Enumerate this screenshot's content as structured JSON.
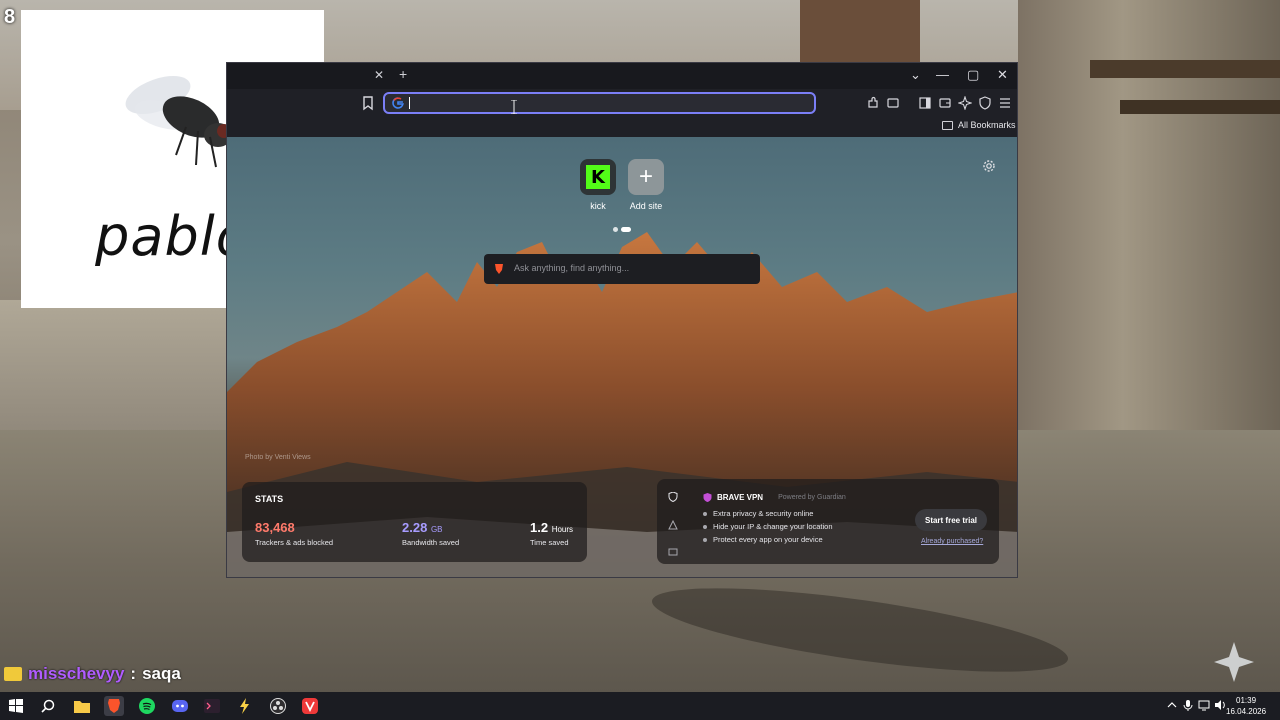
{
  "game": {
    "hud_number": "8"
  },
  "overlay": {
    "caption": "pablo"
  },
  "browser": {
    "tab_close": "✕",
    "tab_new": "+",
    "window_controls": {
      "dropdown": "⌄",
      "minimize": "—",
      "maximize": "▢",
      "close": "✕"
    },
    "address": {
      "value": "",
      "placeholder": ""
    },
    "bookmarks_bar": {
      "all_bookmarks": "All Bookmarks"
    },
    "accent_color": "#7b7ff7"
  },
  "new_tab": {
    "top_sites": [
      {
        "label": "kick",
        "icon": "kick-icon"
      },
      {
        "label": "Add site",
        "icon": "plus-icon"
      }
    ],
    "ask_placeholder": "Ask anything, find anything...",
    "photo_credit": "Photo by Venti Views",
    "stats": {
      "title": "STATS",
      "items": [
        {
          "value": "83,468",
          "unit": "",
          "label": "Trackers & ads blocked",
          "color": "#ff7a6b"
        },
        {
          "value": "2.28",
          "unit": "GB",
          "label": "Bandwidth saved",
          "color": "#a89cff"
        },
        {
          "value": "1.2",
          "unit": "Hours",
          "label": "Time saved",
          "color": "#ffffff"
        }
      ]
    },
    "vpn": {
      "title": "BRAVE VPN",
      "powered_by": "Powered by Guardian",
      "features": [
        "Extra privacy & security online",
        "Hide your IP & change your location",
        "Protect every app on your device"
      ],
      "cta": "Start free trial",
      "link": "Already purchased?"
    }
  },
  "chat": {
    "username": "misschevyy",
    "separator": ":",
    "message": "saqa",
    "username_color": "#b05cff"
  },
  "taskbar": {
    "time": "01:39",
    "date": "16.04.2026",
    "apps": [
      "windows-start-icon",
      "search-icon",
      "file-explorer-icon",
      "brave-icon",
      "spotify-icon",
      "discord-icon",
      "terminal-icon",
      "tool-icon",
      "obs-icon",
      "vivaldi-icon"
    ]
  }
}
